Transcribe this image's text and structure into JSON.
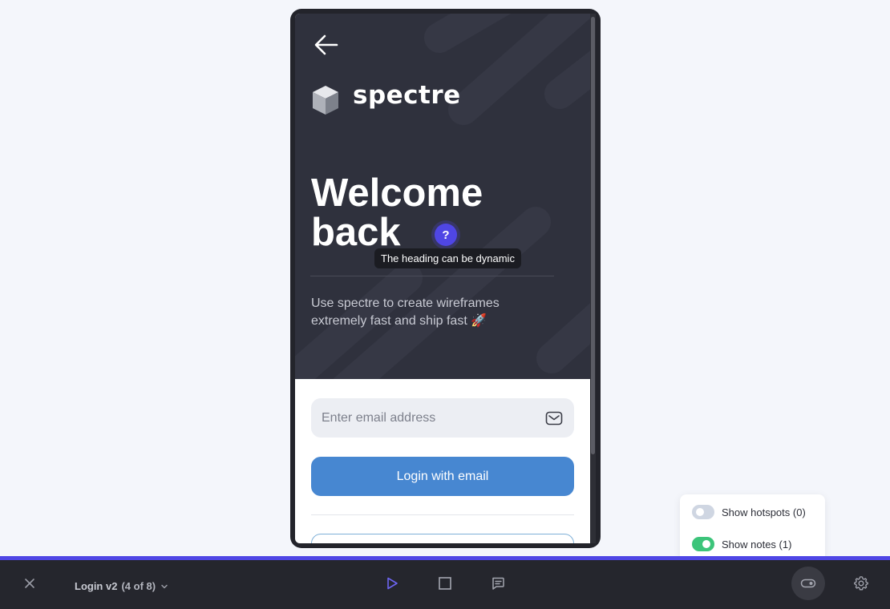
{
  "app": {
    "logo_text": "spectre",
    "heading_line1": "Welcome",
    "heading_line2": "back",
    "note_marker": "?",
    "note_tooltip": "The heading can be dynamic",
    "subtitle": "Use spectre to create wireframes extremely fast and ship fast 🚀",
    "email_placeholder": "Enter email address",
    "login_label": "Login with email"
  },
  "toolbar": {
    "prototype_name": "Login v2",
    "screen_count": "(4 of 8)",
    "icons": [
      "close-icon",
      "chevron-down-icon",
      "play-icon",
      "frame-icon",
      "comment-icon",
      "toggle-icon",
      "gear-icon"
    ]
  },
  "popover": {
    "hotspots_label": "Show hotspots (0)",
    "hotspots_on": false,
    "notes_label": "Show notes (1)",
    "notes_on": true
  },
  "colors": {
    "accent": "#4f46e5",
    "hero_bg": "#2f313d",
    "login_button": "#4787d1",
    "toggle_on": "#3cc47a",
    "toolbar_bg": "#25262d"
  }
}
